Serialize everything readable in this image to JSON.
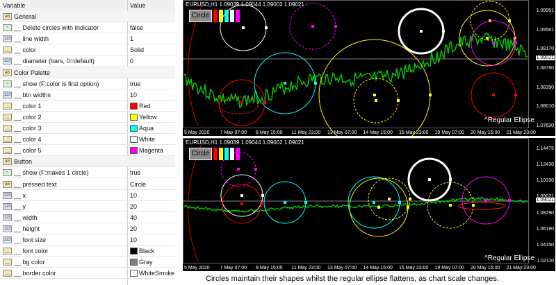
{
  "props": {
    "header_variable": "Variable",
    "header_value": "Value",
    "rows": [
      {
        "icon": "ab",
        "name": "General",
        "value": "",
        "group": true
      },
      {
        "icon": "~",
        "name": "__ Delete circles with Indicator",
        "value": "false"
      },
      {
        "icon": "123",
        "name": "__ line width",
        "value": "1"
      },
      {
        "icon": "__",
        "name": "__ color",
        "value": "Solid"
      },
      {
        "icon": "123",
        "name": "__ diameter (bars, 0=default)",
        "value": "0"
      },
      {
        "icon": "ab",
        "name": "Color Palette",
        "value": "",
        "group": true
      },
      {
        "icon": "~",
        "name": "__ show (F:color is first option)",
        "value": "true"
      },
      {
        "icon": "123",
        "name": "__ btn widths",
        "value": "10"
      },
      {
        "icon": "__",
        "name": "__ color 1",
        "value": "Red",
        "swatch": "#ff0000"
      },
      {
        "icon": "__",
        "name": "__ color 2",
        "value": "Yellow",
        "swatch": "#ffff00"
      },
      {
        "icon": "__",
        "name": "__ color 3",
        "value": "Aqua",
        "swatch": "#00ffff"
      },
      {
        "icon": "__",
        "name": "__ color 4",
        "value": "White",
        "swatch": "#ffffff"
      },
      {
        "icon": "__",
        "name": "__ color 5",
        "value": "Magenta",
        "swatch": "#ff00ff"
      },
      {
        "icon": "ab",
        "name": "Button",
        "value": "",
        "group": true
      },
      {
        "icon": "~",
        "name": "__ show (F:makes 1 circle)",
        "value": "true"
      },
      {
        "icon": "ab",
        "name": "__ pressed text",
        "value": "Circle"
      },
      {
        "icon": "123",
        "name": "__ x",
        "value": "10"
      },
      {
        "icon": "123",
        "name": "__ y",
        "value": "20"
      },
      {
        "icon": "123",
        "name": "__ width",
        "value": "40"
      },
      {
        "icon": "123",
        "name": "__ height",
        "value": "20"
      },
      {
        "icon": "123",
        "name": "__ font size",
        "value": "10"
      },
      {
        "icon": "__",
        "name": "__ font color",
        "value": "Black",
        "swatch": "#000000"
      },
      {
        "icon": "__",
        "name": "__ bg color",
        "value": "Gray",
        "swatch": "#808080"
      },
      {
        "icon": "__",
        "name": "__ border color",
        "value": "WhiteSmoke",
        "swatch": "#f5f5f5"
      }
    ]
  },
  "charts": [
    {
      "id": "top",
      "title": "EURUSD,H1  1.09039 1.09044 1.09002 1.09021",
      "button_label": "Circle",
      "button_colors": [
        "#ff0000",
        "#ffff00",
        "#00ffff",
        "#ffffff",
        "#ff00ff"
      ],
      "y_labels": [
        "1.09951",
        "1.09561",
        "1.09170",
        "1.08780",
        "1.08390",
        "1.08010",
        "1.07630"
      ],
      "price_tag": "1.09021",
      "x_labels": [
        "5 May 2020",
        "7 May 07:00",
        "8 May 15:00",
        "11 May 23:00",
        "13 May 07:00",
        "14 May 15:00",
        "15 May 23:00",
        "19 May 07:00",
        "20 May 15:00",
        "21 May 23:00"
      ],
      "ellipse_label": "^Regular Ellipse"
    },
    {
      "id": "bottom",
      "title": "EURUSD,H1  1.09039 1.09044 1.09002 1.09021",
      "button_label": "Circle",
      "button_colors": [
        "#ff0000",
        "#ffff00",
        "#00ffff",
        "#ffffff",
        "#ff00ff"
      ],
      "y_labels": [
        "1.14475",
        "1.12430",
        "1.10330",
        "1.09021",
        "1.08290",
        "1.06190",
        "1.04150",
        "1.02110"
      ],
      "price_tag": "1.09021",
      "x_labels": [
        "5 May 2020",
        "7 May 07:00",
        "8 May 15:00",
        "11 May 23:00",
        "13 May 07:00",
        "14 May 15:00",
        "15 May 23:00",
        "19 May 07:00",
        "20 May 15:00",
        "21 May 23:00"
      ],
      "ellipse_label": "^Regular Ellipse"
    }
  ],
  "caption": "Circles maintain their shapes whilst the regular ellipse flattens, as chart scale changes."
}
